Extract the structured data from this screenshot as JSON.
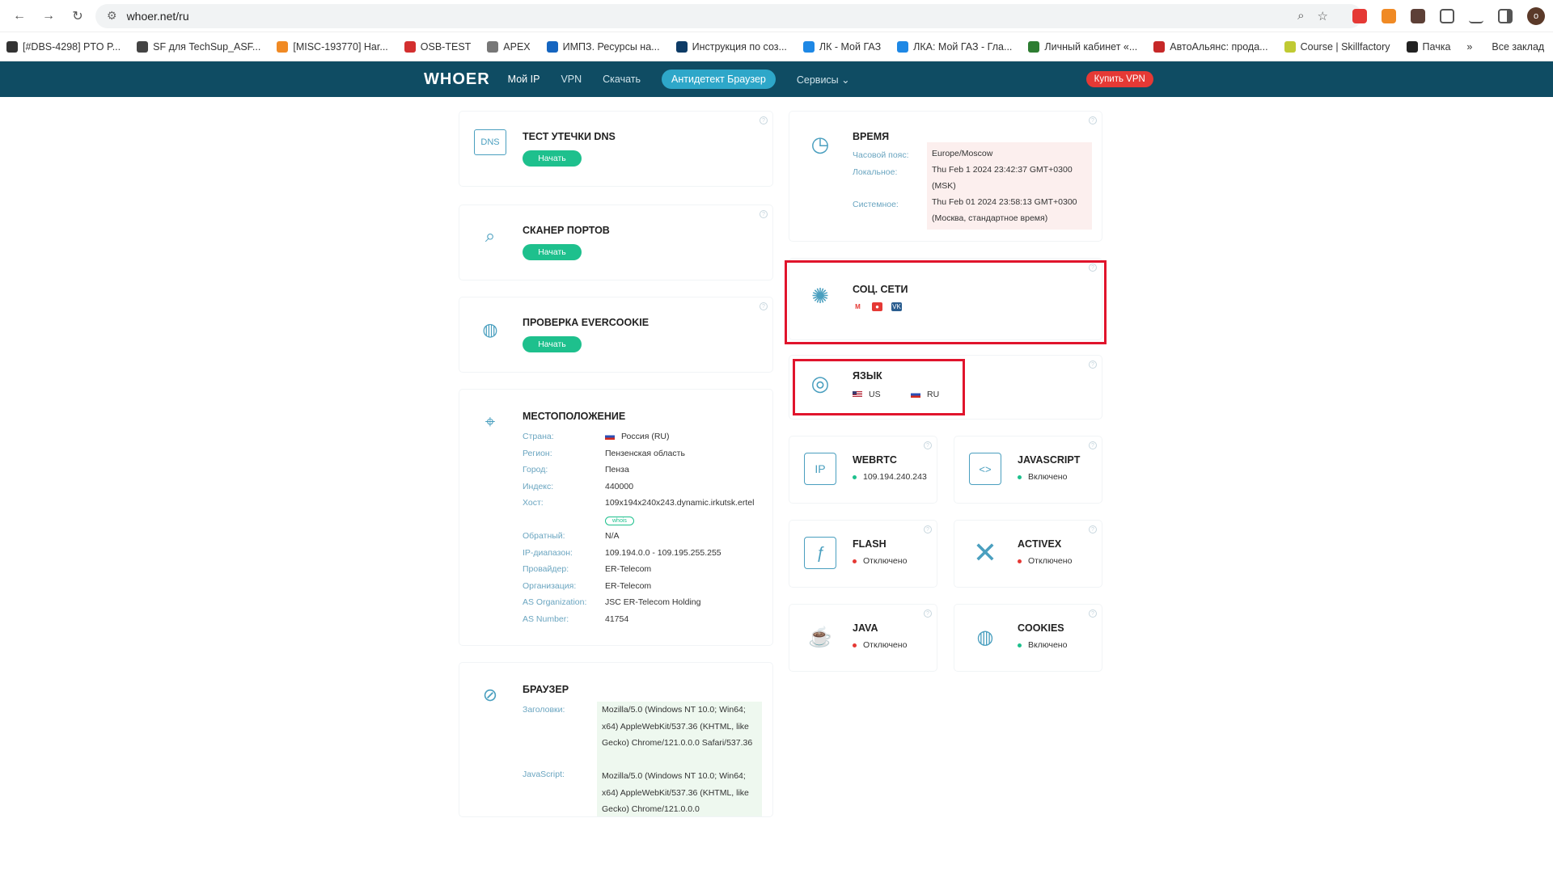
{
  "browser": {
    "url": "whoer.net/ru",
    "avatar_letter": "o",
    "bookmarks": [
      {
        "label": "[#DBS-4298] PTO P...",
        "color": "#333"
      },
      {
        "label": "SF для TechSup_ASF...",
        "color": "#444"
      },
      {
        "label": "[MISC-193770] Нar...",
        "color": "#f08a24"
      },
      {
        "label": "OSB-TEST",
        "color": "#d32f2f"
      },
      {
        "label": "APEX",
        "color": "#777"
      },
      {
        "label": "ИМПЗ. Ресурсы на...",
        "color": "#1565c0"
      },
      {
        "label": "Инструкция по соз...",
        "color": "#0d3b66"
      },
      {
        "label": "ЛК - Мой ГАЗ",
        "color": "#1e88e5"
      },
      {
        "label": "ЛКА: Мой ГАЗ - Гла...",
        "color": "#1e88e5"
      },
      {
        "label": "Личный кабинет «...",
        "color": "#2e7d32"
      },
      {
        "label": "АвтоАльянс: прода...",
        "color": "#c62828"
      },
      {
        "label": "Course | Skillfactory",
        "color": "#c0ca33"
      },
      {
        "label": "Пачка",
        "color": "#222"
      }
    ],
    "more_bookmarks": "»",
    "all_bookmarks": "Все заклад"
  },
  "site": {
    "logo": "WHOER",
    "nav": [
      "Мой IP",
      "VPN",
      "Скачать"
    ],
    "nav_pill": "Антидетект Браузер",
    "nav_services": "Сервисы ⌄",
    "buy": "Купить VPN"
  },
  "cards": {
    "dns": {
      "title": "ТЕСТ УТЕЧКИ DNS",
      "button": "Начать",
      "icon_text": "DNS"
    },
    "ports": {
      "title": "СКАНЕР ПОРТОВ",
      "button": "Начать"
    },
    "evercookie": {
      "title": "ПРОВЕРКА EVERCOOKIE",
      "button": "Начать"
    },
    "location": {
      "title": "МЕСТОПОЛОЖЕНИЕ",
      "rows": [
        {
          "k": "Страна:",
          "v": "Россия (RU)"
        },
        {
          "k": "Регион:",
          "v": "Пензенская область"
        },
        {
          "k": "Город:",
          "v": "Пенза"
        },
        {
          "k": "Индекс:",
          "v": "440000"
        },
        {
          "k": "Хост:",
          "v": "109x194x240x243.dynamic.irkutsk.ertel"
        },
        {
          "k": "Обратный:",
          "v": "N/A"
        },
        {
          "k": "IP-диапазон:",
          "v": "109.194.0.0 - 109.195.255.255"
        },
        {
          "k": "Провайдер:",
          "v": "ER-Telecom"
        },
        {
          "k": "Организация:",
          "v": "ER-Telecom"
        },
        {
          "k": "AS Organization:",
          "v": "JSC ER-Telecom Holding"
        },
        {
          "k": "AS Number:",
          "v": "41754"
        }
      ],
      "whois": "whois"
    },
    "browser": {
      "title": "БРАУЗЕР",
      "headers_label": "Заголовки:",
      "headers_value": "Mozilla/5.0 (Windows NT 10.0; Win64; x64) AppleWebKit/537.36 (KHTML, like Gecko) Chrome/121.0.0.0 Safari/537.36",
      "js_label": "JavaScript:",
      "js_value": "Mozilla/5.0 (Windows NT 10.0; Win64; x64) AppleWebKit/537.36 (KHTML, like Gecko) Chrome/121.0.0.0"
    },
    "time": {
      "title": "ВРЕМЯ",
      "tz_label": "Часовой пояс:",
      "tz_value": "Europe/Moscow",
      "local_label": "Локальное:",
      "local_value": "Thu Feb 1 2024 23:42:37 GMT+0300 (MSK)",
      "system_label": "Системное:",
      "system_value": "Thu Feb 01 2024 23:58:13 GMT+0300 (Москва, стандартное время)"
    },
    "social": {
      "title": "СОЦ. СЕТИ",
      "items": [
        "M",
        "●",
        "VK"
      ]
    },
    "language": {
      "title": "ЯЗЫК",
      "lang1": "US",
      "lang2": "RU"
    },
    "webrtc": {
      "title": "WEBRTC",
      "status": "109.194.240.243",
      "icon_text": "IP"
    },
    "javascript": {
      "title": "JAVASCRIPT",
      "status": "Включено"
    },
    "flash": {
      "title": "FLASH",
      "status": "Отключено"
    },
    "activex": {
      "title": "ACTIVEX",
      "status": "Отключено"
    },
    "java": {
      "title": "JAVA",
      "status": "Отключено"
    },
    "cookies": {
      "title": "COOKIES",
      "status": "Включено"
    }
  },
  "colors": {
    "header": "#0f4c63",
    "accent": "#2ea7c9",
    "green": "#1ec08d",
    "red": "#e53935",
    "highlight": "#e0142c"
  }
}
